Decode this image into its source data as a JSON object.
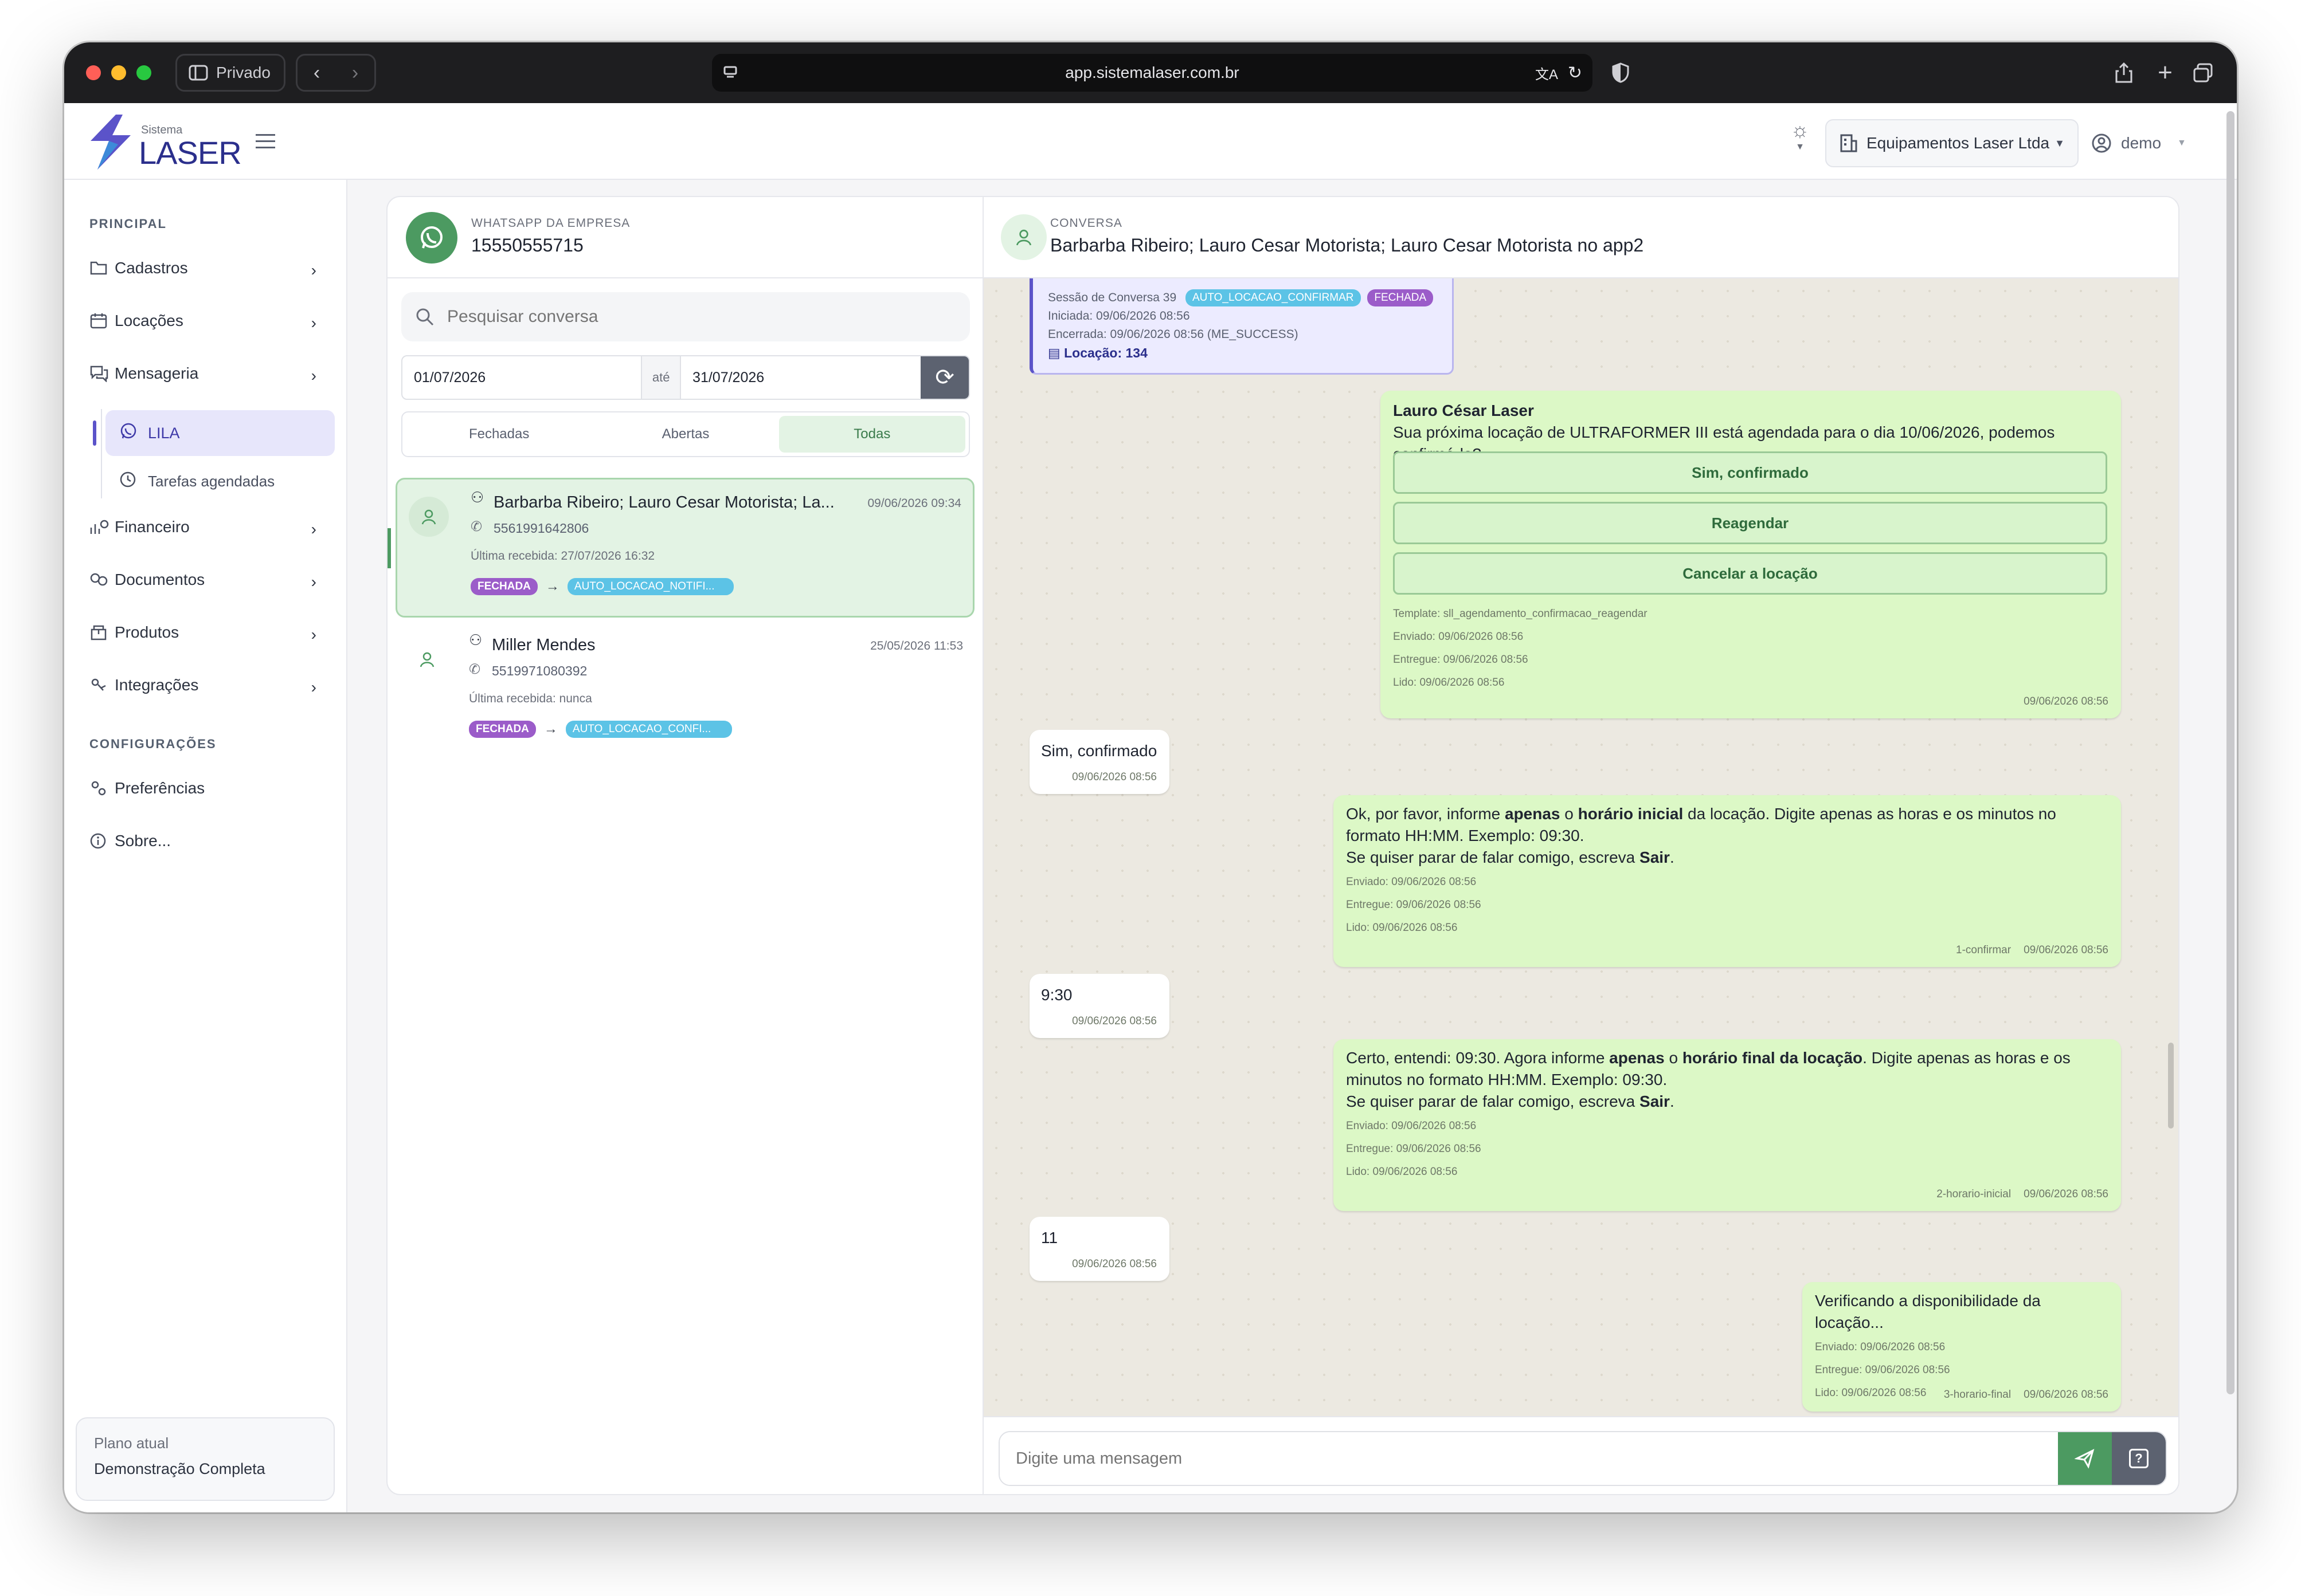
{
  "browser": {
    "private_label": "Privado",
    "url": "app.sistemalaser.com.br"
  },
  "header": {
    "logo_small": "Sistema",
    "logo_big": "LASER",
    "company": "Equipamentos Laser Ltda",
    "user": "demo"
  },
  "sidebar": {
    "section_principal": "PRINCIPAL",
    "items": [
      {
        "label": "Cadastros"
      },
      {
        "label": "Locações"
      },
      {
        "label": "Mensageria"
      }
    ],
    "sub_items": [
      {
        "label": "LILA"
      },
      {
        "label": "Tarefas agendadas"
      }
    ],
    "items2": [
      {
        "label": "Financeiro"
      },
      {
        "label": "Documentos"
      },
      {
        "label": "Produtos"
      },
      {
        "label": "Integrações"
      }
    ],
    "section_config": "CONFIGURAÇÕES",
    "config_items": [
      {
        "label": "Preferências"
      },
      {
        "label": "Sobre..."
      }
    ],
    "plan_label": "Plano atual",
    "plan_value": "Demonstração Completa"
  },
  "left": {
    "wa_label": "WHATSAPP DA EMPRESA",
    "wa_number": "15550555715",
    "search_placeholder": "Pesquisar conversa",
    "date_from": "01/07/2026",
    "date_sep": "até",
    "date_to": "31/07/2026",
    "tabs": [
      {
        "label": "Fechadas"
      },
      {
        "label": "Abertas"
      },
      {
        "label": "Todas"
      }
    ],
    "conversations": [
      {
        "name": "Barbarba Ribeiro; Lauro Cesar Motorista; La...",
        "date": "09/06/2026 09:34",
        "phone": "5561991642806",
        "last": "Última recebida: 27/07/2026 16:32",
        "tag1": "FECHADA",
        "tag2": "AUTO_LOCACAO_NOTIFI..."
      },
      {
        "name": "Miller Mendes",
        "date": "25/05/2026 11:53",
        "phone": "5519971080392",
        "last": "Última recebida: nunca",
        "tag1": "FECHADA",
        "tag2": "AUTO_LOCACAO_CONFI..."
      }
    ]
  },
  "chat": {
    "label": "CONVERSA",
    "title": "Barbarba Ribeiro; Lauro Cesar Motorista; Lauro Cesar Motorista no app2",
    "session": {
      "title": "Sessão de Conversa 39",
      "tag1": "AUTO_LOCACAO_CONFIRMAR",
      "tag2": "FECHADA",
      "started": "Iniciada: 09/06/2026 08:56",
      "ended": "Encerrada: 09/06/2026 08:56 (ME_SUCCESS)",
      "rental": "Locação: 134"
    },
    "m1": {
      "sender": "Lauro César Laser",
      "text": "Sua próxima locação de ULTRAFORMER III está agendada para o dia 10/06/2026, podemos confirmá-la?",
      "btn1": "Sim, confirmado",
      "btn2": "Reagendar",
      "btn3": "Cancelar a locação",
      "template": "Template: sll_agendamento_confirmacao_reagendar",
      "sent": "Enviado: 09/06/2026 08:56",
      "delivered": "Entregue: 09/06/2026 08:56",
      "read": "Lido: 09/06/2026 08:56",
      "time": "09/06/2026 08:56"
    },
    "r1": {
      "text": "Sim, confirmado",
      "time": "09/06/2026 08:56"
    },
    "m2": {
      "t1": "Ok, por favor, informe ",
      "b1": "apenas",
      "t2": " o ",
      "b2": "horário inicial",
      "t3": " da locação. Digite apenas as horas e os minutos no formato HH:MM. Exemplo: 09:30.",
      "t4": "Se quiser parar de falar comigo, escreva ",
      "b3": "Sair",
      "t5": ".",
      "sent": "Enviado: 09/06/2026 08:56",
      "delivered": "Entregue: 09/06/2026 08:56",
      "read": "Lido: 09/06/2026 08:56",
      "step": "1-confirmar",
      "time": "09/06/2026 08:56"
    },
    "r2": {
      "text": "9:30",
      "time": "09/06/2026 08:56"
    },
    "m3": {
      "t1": "Certo, entendi: 09:30. Agora informe ",
      "b1": "apenas",
      "t2": " o ",
      "b2": "horário final da locação",
      "t3": ". Digite apenas as horas e os minutos no formato HH:MM. Exemplo: 09:30.",
      "t4": "Se quiser parar de falar comigo, escreva ",
      "b3": "Sair",
      "t5": ".",
      "sent": "Enviado: 09/06/2026 08:56",
      "delivered": "Entregue: 09/06/2026 08:56",
      "read": "Lido: 09/06/2026 08:56",
      "step": "2-horario-inicial",
      "time": "09/06/2026 08:56"
    },
    "r3": {
      "text": "11",
      "time": "09/06/2026 08:56"
    },
    "m4": {
      "text": "Verificando a disponibilidade da locação...",
      "sent": "Enviado: 09/06/2026 08:56",
      "delivered": "Entregue: 09/06/2026 08:56",
      "read": "Lido: 09/06/2026 08:56",
      "step": "3-horario-final",
      "time": "09/06/2026 08:56"
    },
    "composer_placeholder": "Digite uma mensagem"
  },
  "colors": {
    "accent": "#4c9a61",
    "purple": "#9b5cc9",
    "cyan": "#5cc3e6",
    "nav_active": "#e7e6fb"
  }
}
